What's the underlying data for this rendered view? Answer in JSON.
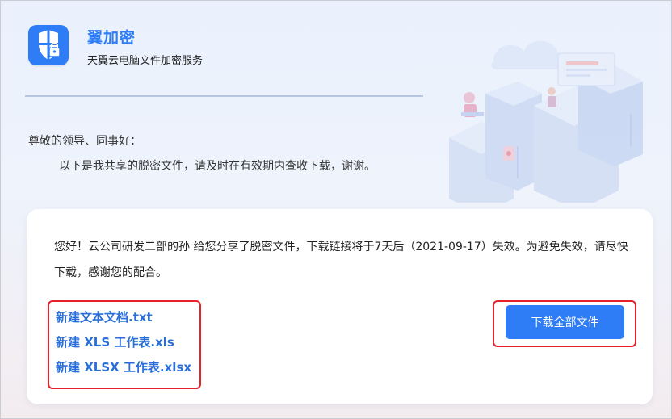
{
  "header": {
    "app_name": "翼加密",
    "subtitle": "天翼云电脑文件加密服务"
  },
  "letter": {
    "greeting": "尊敬的领导、同事好：",
    "intro": "以下是我共享的脱密文件，请及时在有效期内查收下载，谢谢。"
  },
  "share": {
    "message": "您好！云公司研发二部的孙     给您分享了脱密文件，下载链接将于7天后（2021-09-17）失效。为避免失效，请尽快下载，感谢您的配合。",
    "files": [
      "新建文本文档.txt",
      "新建 XLS 工作表.xls",
      "新建 XLSX 工作表.xlsx"
    ],
    "download_all_label": "下载全部文件"
  },
  "colors": {
    "accent": "#2f7df6",
    "link": "#2a6fd8",
    "highlight": "#e8202a"
  },
  "icons": {
    "logo": "shield-lock-icon"
  }
}
